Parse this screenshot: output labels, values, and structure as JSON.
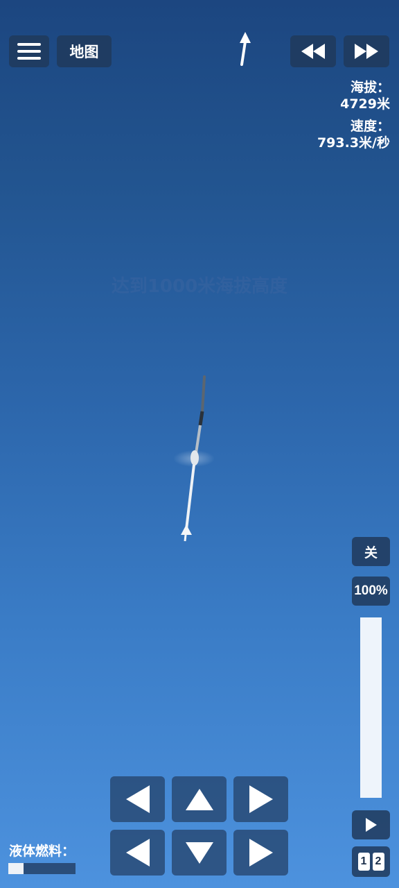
{
  "toolbar": {
    "menu_icon": "hamburger-menu-icon",
    "map_label": "地图",
    "rewind_icon": "rewind-icon",
    "fast_forward_icon": "fast-forward-icon",
    "heading_icon": "heading-arrow-icon"
  },
  "telemetry": {
    "altitude_label": "海拔：",
    "altitude_value": "4729米",
    "speed_label": "速度：",
    "speed_value": "793.3米/秒"
  },
  "objective": "达到1000米海拔高度",
  "controls": {
    "engine_toggle_label": "关",
    "throttle_label": "100%",
    "throttle_level": 1.0,
    "stage_icon": "play-stage-icon",
    "page_numbers": [
      "1",
      "2"
    ]
  },
  "dpad": {
    "icons": [
      "left-arrow-icon",
      "up-arrow-icon",
      "right-arrow-icon",
      "left-arrow-icon",
      "down-arrow-icon",
      "right-arrow-icon"
    ]
  },
  "fuel": {
    "label": "液体燃料：",
    "level": 0.23
  },
  "colors": {
    "sky_top": "#1c4680",
    "sky_bottom": "#4d92de",
    "button_bg": "#203a5c"
  }
}
